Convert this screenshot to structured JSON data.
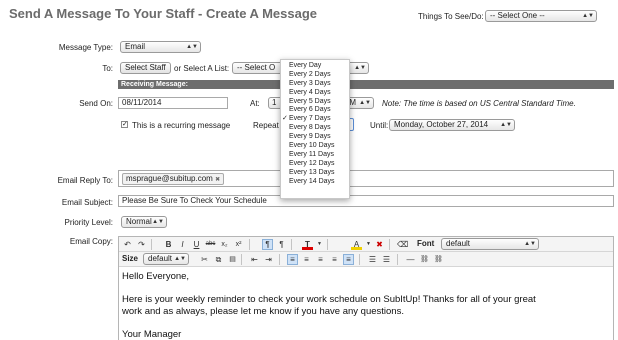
{
  "page": {
    "title": "Send A Message To Your Staff - Create A Message"
  },
  "things": {
    "label": "Things To See/Do:",
    "value": "-- Select One --"
  },
  "message_type": {
    "label": "Message Type:",
    "value": "Email"
  },
  "to": {
    "label": "To:",
    "select_staff": "Select Staff",
    "or_list": "or Select A List:",
    "list_value": "-- Select O"
  },
  "receiving_bar": "Receiving Message:",
  "send_on": {
    "label": "Send On:",
    "value": "08/11/2014",
    "at_label": "At:",
    "time_partial_a": "1",
    "time_partial_b": "AM",
    "note": "Note: The time is based on US Central Standard Time."
  },
  "recurring": {
    "check": "✓",
    "label": "This is a recurring message",
    "repeat_label": "Repeat",
    "repeat_check": "✓",
    "until_label": "Until:",
    "until_value": "Monday, October 27, 2014"
  },
  "repeat_options": [
    "Every Day",
    "Every 2 Days",
    "Every 3 Days",
    "Every 4 Days",
    "Every 5 Days",
    "Every 6 Days",
    "Every 7 Days",
    "Every 8 Days",
    "Every 9 Days",
    "Every 10 Days",
    "Every 11 Days",
    "Every 12 Days",
    "Every 13 Days",
    "Every 14 Days"
  ],
  "repeat_selected_index": 6,
  "reply_to": {
    "label": "Email Reply To:",
    "token": "msprague@subitup.com",
    "remove": "✖"
  },
  "subject": {
    "label": "Email Subject:",
    "value": "Please Be Sure To Check Your Schedule"
  },
  "priority": {
    "label": "Priority Level:",
    "value": "Normal"
  },
  "copy": {
    "label": "Email Copy:",
    "font_label": "Font",
    "font_value": "default",
    "size_label": "Size",
    "size_value": "default",
    "lines": [
      "Hello Everyone,",
      "",
      "Here is your weekly reminder to check your work schedule on SubItUp!   Thanks for all of your great",
      "work and as always, please let me know if you have any questions.",
      "",
      "Your Manager"
    ]
  },
  "colors": {
    "bar": "#6d6d6d",
    "title": "#6b6b6b",
    "highlight": "#cfe2f7"
  },
  "icons": {
    "undo": "↶",
    "redo": "↷",
    "bold": "B",
    "italic": "I",
    "underline": "U",
    "strike": "abc",
    "sub": "x₂",
    "sup": "x²",
    "ltr": "¶",
    "rtl": "¶",
    "text_color": "T",
    "bg_color": "A",
    "eraser": "⌫",
    "cut": "✂",
    "copy": "⧉",
    "paste": "📋",
    "indent_out": "⇤",
    "indent_in": "⇥",
    "align": "≡",
    "list": "☰",
    "hr": "—",
    "link": "🔗"
  }
}
